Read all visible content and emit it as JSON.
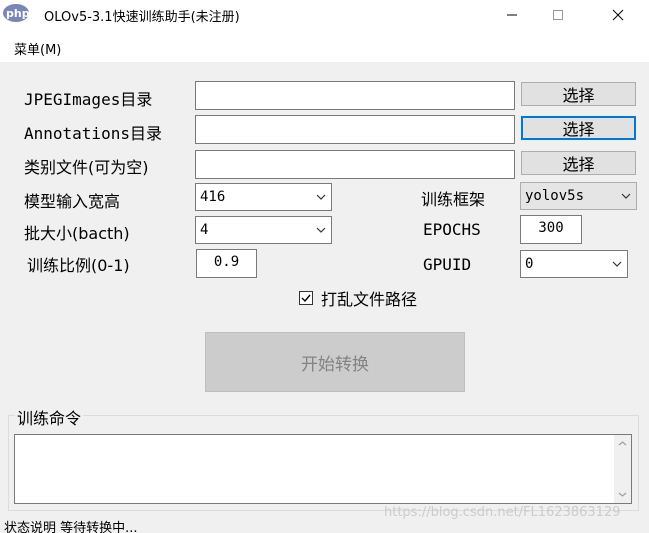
{
  "window": {
    "title": "OLOv5-3.1快速训练助手(未注册)",
    "logo_text": "php中文网"
  },
  "menu": {
    "items": [
      {
        "label": "菜单(M)"
      }
    ]
  },
  "form": {
    "jpeg_label": "JPEGImages目录",
    "jpeg_value": "",
    "annotations_label": "Annotations目录",
    "annotations_value": "",
    "classes_label": "类别文件(可为空)",
    "classes_value": "",
    "select_label": "选择",
    "input_size_label": "模型输入宽高",
    "input_size_value": "416",
    "batch_label": "批大小(bacth)",
    "batch_value": "4",
    "ratio_label": "训练比例(0-1)",
    "ratio_value": "0.9",
    "framework_label": "训练框架",
    "framework_value": "yolov5s",
    "epochs_label": "EPOCHS",
    "epochs_value": "300",
    "gpuid_label": "GPUID",
    "gpuid_value": "0",
    "shuffle_label": "打乱文件路径",
    "shuffle_checked": true,
    "start_label": "开始转换"
  },
  "command": {
    "group_label": "训练命令",
    "value": ""
  },
  "status": {
    "text": "状态说明  等待转换中..."
  },
  "watermark": {
    "text": "https://blog.csdn.net/FL1623863129"
  },
  "colors": {
    "focus": "#0078d7",
    "client_bg": "#f0f0f0",
    "disabled_text": "#838383"
  }
}
